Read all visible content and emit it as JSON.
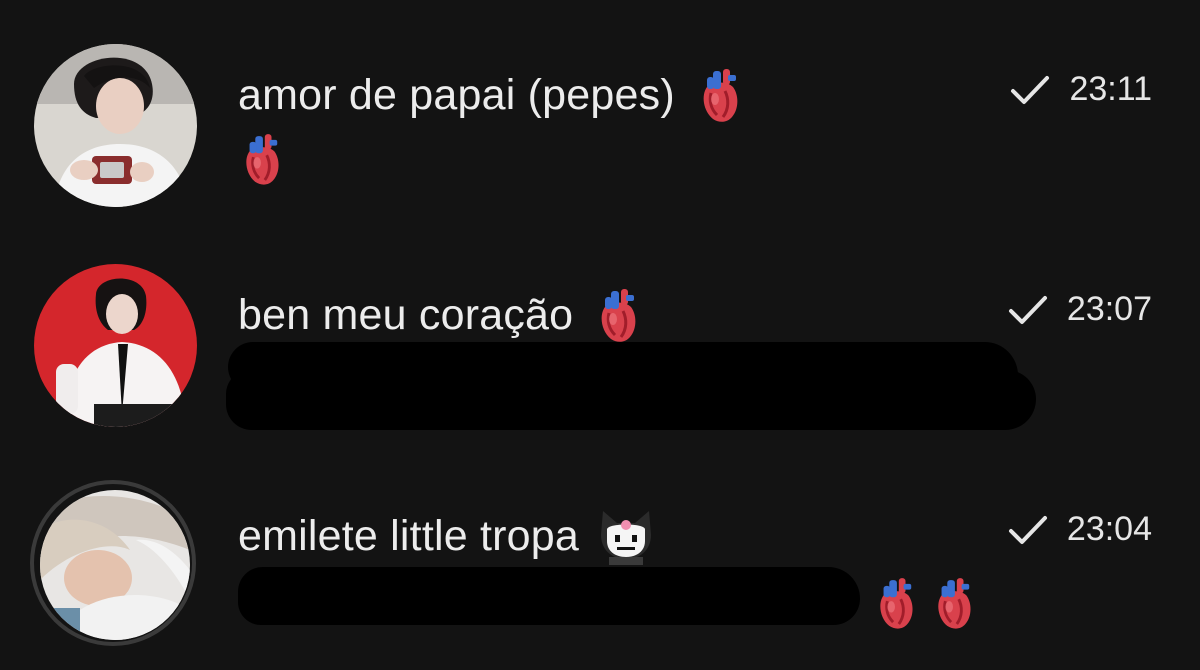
{
  "chats": [
    {
      "name": "amor de papai (pepes)",
      "name_emoji": "anatomical-heart",
      "time": "23:11",
      "status": "sent-check",
      "preview_emojis": [
        "anatomical-heart"
      ],
      "avatar": "photo-person-holding-camera"
    },
    {
      "name": "ben meu coração",
      "name_emoji": "anatomical-heart",
      "time": "23:07",
      "status": "sent-check",
      "preview_redacted": true,
      "avatar": "photo-person-red-background"
    },
    {
      "name": "emilete little tropa",
      "name_emoji": "kuromi",
      "time": "23:04",
      "status": "sent-check",
      "preview_redacted": true,
      "preview_emojis": [
        "anatomical-heart",
        "anatomical-heart"
      ],
      "avatar": "photo-person-lying-down",
      "has_story_ring": true
    }
  ],
  "colors": {
    "background": "#131313",
    "text_primary": "#ececec",
    "story_ring": "#3a3a3a"
  }
}
